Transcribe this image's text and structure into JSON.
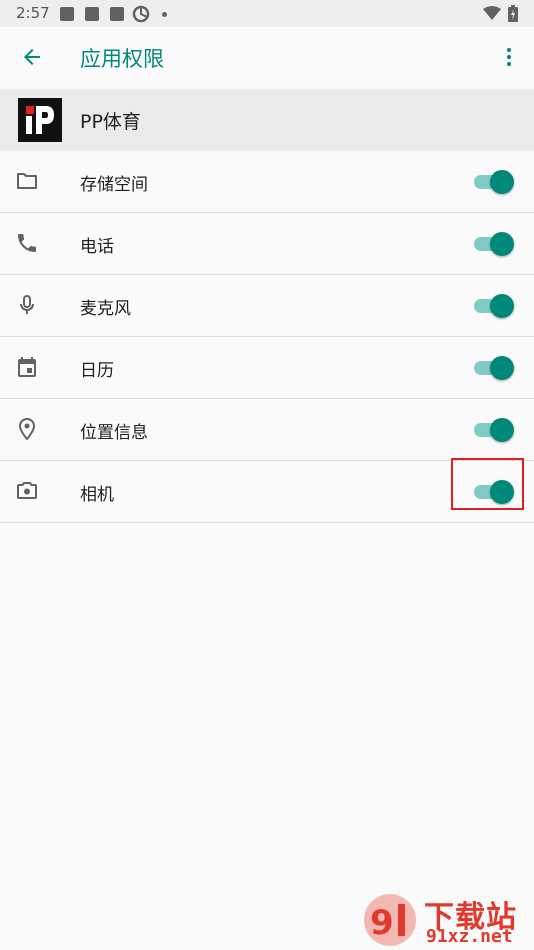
{
  "status_bar": {
    "time": "2:57",
    "left_icons": [
      "notification-icon",
      "notification-icon",
      "notification-icon",
      "sync-icon",
      "dot-icon"
    ],
    "right_icons": [
      "wifi-icon",
      "battery-icon"
    ]
  },
  "app_bar": {
    "title": "应用权限",
    "back_icon": "arrow-back-icon",
    "more_icon": "more-vert-icon"
  },
  "app": {
    "name": "PP体育",
    "logo_icon": "pp-sports-logo"
  },
  "permissions": [
    {
      "label": "存储空间",
      "icon": "folder-icon",
      "enabled": true
    },
    {
      "label": "电话",
      "icon": "phone-icon",
      "enabled": true
    },
    {
      "label": "麦克风",
      "icon": "microphone-icon",
      "enabled": true
    },
    {
      "label": "日历",
      "icon": "calendar-icon",
      "enabled": true
    },
    {
      "label": "位置信息",
      "icon": "location-icon",
      "enabled": true
    },
    {
      "label": "相机",
      "icon": "camera-icon",
      "enabled": true
    }
  ],
  "watermark": {
    "text_top": "下载站",
    "text_bottom": "91xz.net"
  },
  "colors": {
    "accent": "#00897b",
    "toggle_track": "#80cbc4",
    "highlight": "#e02020"
  }
}
